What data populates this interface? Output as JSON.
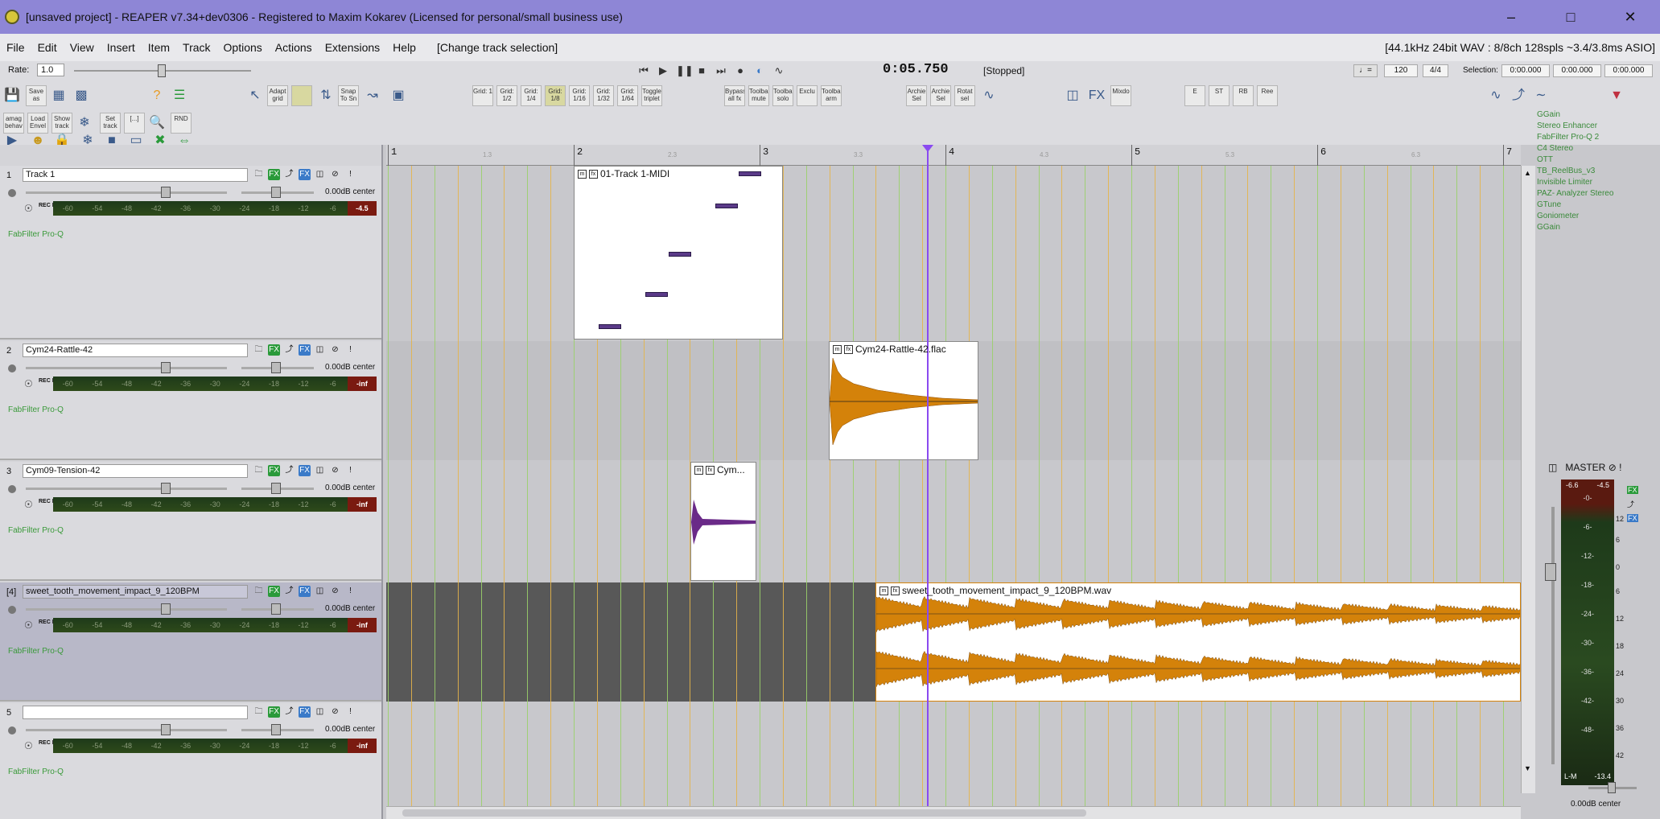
{
  "window": {
    "title": "[unsaved project] - REAPER v7.34+dev0306 - Registered to Maxim Kokarev (Licensed for personal/small business use)",
    "minimize_icon": "minimize-icon",
    "maximize_icon": "maximize-icon",
    "close_icon": "close-icon"
  },
  "menu": {
    "items": [
      "File",
      "Edit",
      "View",
      "Insert",
      "Item",
      "Track",
      "Options",
      "Actions",
      "Extensions",
      "Help"
    ],
    "action_text": "[Change track selection]",
    "format_info": "[44.1kHz 24bit WAV : 8/8ch 128spls ~3.4/3.8ms ASIO]"
  },
  "transport": {
    "rate_label": "Rate:",
    "rate_value": "1.0",
    "time": "0:05.750",
    "status": "[Stopped]",
    "bpm": "120",
    "timesig": "4/4",
    "selection_label": "Selection:",
    "sel_start": "0:00.000",
    "sel_end": "0:00.000",
    "sel_len": "0:00.000"
  },
  "toolbar": {
    "row1_buttons": [
      "Save as",
      "Adapt grid",
      "Snap To Sn",
      "Grid: 1",
      "Grid: 1/2",
      "Grid: 1/4",
      "Grid: 1/8",
      "Grid: 1/16",
      "Grid: 1/32",
      "Grid: 1/64",
      "Toggle triplet",
      "Bypass all fx",
      "Toolbar mute",
      "Toolbar solo",
      "Exclu",
      "Toolbar arm",
      "Archie Sel",
      "Archie Sel",
      "Rotat sel",
      "Mixdo",
      "E",
      "ST",
      "RB",
      "Ree"
    ],
    "row2_buttons": [
      "amag behav",
      "Load Envel",
      "Show track",
      "Set track",
      "[...]",
      "RND"
    ]
  },
  "tracks": [
    {
      "num": "1",
      "name": "Track 1",
      "vol": "0.00dB center",
      "peak": "-4.5",
      "fx": "FabFilter Pro-Q",
      "selected": false
    },
    {
      "num": "2",
      "name": "Cym24-Rattle-42",
      "vol": "0.00dB center",
      "peak": "-inf",
      "fx": "FabFilter Pro-Q",
      "selected": false
    },
    {
      "num": "3",
      "name": "Cym09-Tension-42",
      "vol": "0.00dB center",
      "peak": "-inf",
      "fx": "FabFilter Pro-Q",
      "selected": false
    },
    {
      "num": "[4]",
      "name": "sweet_tooth_movement_impact_9_120BPM",
      "vol": "0.00dB center",
      "peak": "-inf",
      "fx": "FabFilter Pro-Q",
      "selected": true
    },
    {
      "num": "5",
      "name": "",
      "vol": "0.00dB center",
      "peak": "-inf",
      "fx": "FabFilter Pro-Q",
      "selected": false
    }
  ],
  "meter_scale": [
    "-60",
    "-54",
    "-48",
    "-42",
    "-36",
    "-30",
    "-24",
    "-18",
    "-12",
    "-6"
  ],
  "rec_in_label": "REC IN",
  "ruler": {
    "bars": [
      "1",
      "2",
      "3",
      "4",
      "5",
      "6",
      "7"
    ],
    "subs": [
      "1.3",
      "2.3",
      "3.3",
      "4.3",
      "5.3",
      "6.3"
    ]
  },
  "items": {
    "midi": "01-Track 1-MIDI",
    "rattle": "Cym24-Rattle-42.flac",
    "tension": "Cym...",
    "sweet": "sweet_tooth_movement_impact_9_120BPM.wav"
  },
  "fx_chain": [
    "GGain",
    "Stereo Enhancer",
    "FabFilter Pro-Q 2",
    "C4 Stereo",
    "OTT",
    "TB_ReelBus_v3",
    "Invisible Limiter",
    "PAZ- Analyzer Stereo",
    "GTune",
    "Goniometer",
    "GGain"
  ],
  "master": {
    "label": "MASTER",
    "peak_l": "-6.6",
    "peak_r": "-4.5",
    "scale": [
      "-0-",
      "-6-",
      "-12-",
      "-18-",
      "-24-",
      "-30-",
      "-36-",
      "-42-",
      "-48-"
    ],
    "side_scale": [
      "12",
      "6",
      "0",
      "6",
      "12",
      "18",
      "24",
      "30",
      "36",
      "42"
    ],
    "mode": "L-M",
    "lufs": "-13.4",
    "vol": "0.00dB center"
  },
  "colors": {
    "title_bg": "#8e86d6",
    "item_audio": "#d4820a",
    "item_midi_note": "#5a3a88",
    "cursor": "#8a4af0",
    "tension_wave": "#6a2a88",
    "fx_text": "#3a9a3a"
  }
}
